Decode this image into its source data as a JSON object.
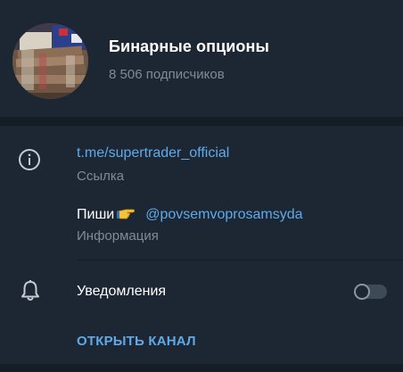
{
  "channel": {
    "name": "Бинарные опционы",
    "subscribers": "8 506 подписчиков"
  },
  "info": {
    "link": "t.me/supertrader_official",
    "link_label": "Ссылка",
    "bio_text": "Пиши",
    "bio_emoji_icon": "pointing-right-hand-icon",
    "bio_mention": "@povsemvoprosamsyda",
    "bio_label": "Информация"
  },
  "notifications": {
    "label": "Уведомления",
    "enabled": false
  },
  "actions": {
    "open_channel": "ОТКРЫТЬ КАНАЛ"
  },
  "colors": {
    "background": "#1d2733",
    "separator": "#151e27",
    "accent": "#5eaaea",
    "secondary_text": "#7d8b99",
    "primary_text": "#ffffff"
  }
}
